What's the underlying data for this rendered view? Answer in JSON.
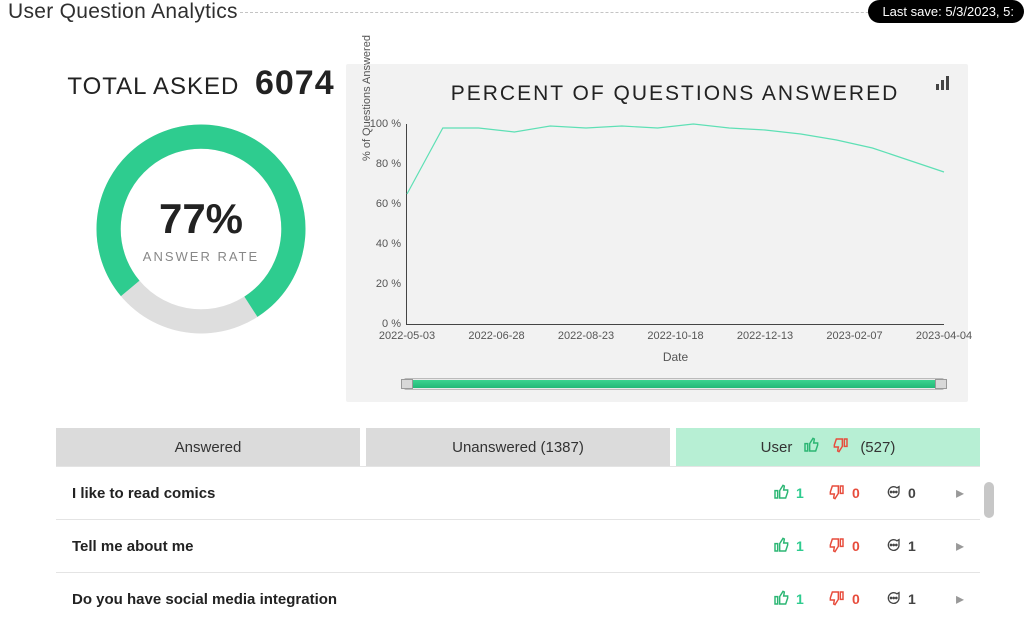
{
  "header": {
    "title": "User Question Analytics",
    "last_save": "Last save: 5/3/2023, 5:"
  },
  "summary": {
    "total_label": "TOTAL ASKED",
    "total_value": "6074",
    "percent": "77%",
    "percent_label": "ANSWER RATE",
    "answer_fraction": 0.77
  },
  "chart_data": {
    "type": "line",
    "title": "PERCENT OF QUESTIONS ANSWERED",
    "xlabel": "Date",
    "ylabel": "% of Questions Answered",
    "ylim": [
      0,
      100
    ],
    "yticks": [
      "0 %",
      "20 %",
      "40 %",
      "60 %",
      "80 %",
      "100 %"
    ],
    "xticks": [
      "2022-05-03",
      "2022-06-28",
      "2022-08-23",
      "2022-10-18",
      "2022-12-13",
      "2023-02-07",
      "2023-04-04"
    ],
    "x": [
      "2022-05-03",
      "2022-05-10",
      "2022-05-17",
      "2022-06-28",
      "2022-07-25",
      "2022-08-23",
      "2022-09-20",
      "2022-10-18",
      "2022-10-25",
      "2022-11-15",
      "2022-12-13",
      "2023-01-10",
      "2023-02-07",
      "2023-03-07",
      "2023-04-04",
      "2023-05-01"
    ],
    "values": [
      65,
      98,
      98,
      96,
      99,
      98,
      99,
      98,
      100,
      98,
      97,
      95,
      92,
      88,
      82,
      76
    ]
  },
  "tabs": {
    "answered": "Answered",
    "unanswered": "Unanswered (1387)",
    "user_label": "User",
    "user_count": "(527)"
  },
  "rows": [
    {
      "text": "I like to read comics",
      "up": "1",
      "down": "0",
      "comments": "0"
    },
    {
      "text": "Tell me about me",
      "up": "1",
      "down": "0",
      "comments": "1"
    },
    {
      "text": "Do you have social media integration",
      "up": "1",
      "down": "0",
      "comments": "1"
    }
  ]
}
